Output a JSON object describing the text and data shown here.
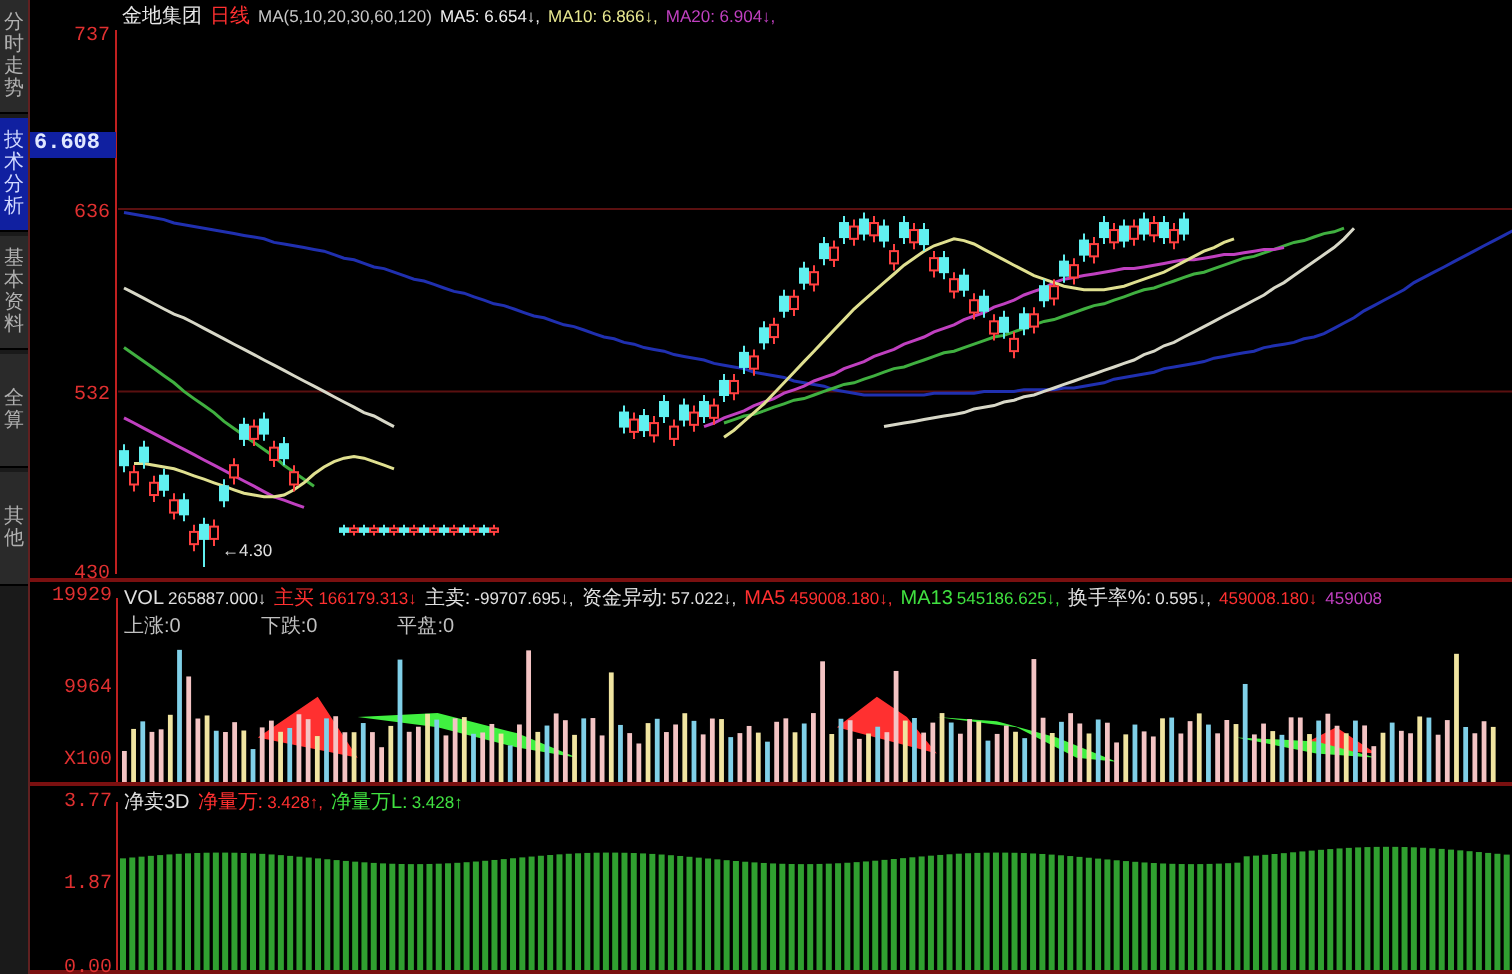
{
  "side_tabs": [
    {
      "label": "分时走势",
      "selected": false
    },
    {
      "label": "技术分析",
      "selected": true
    },
    {
      "label": "基本资料",
      "selected": false
    },
    {
      "label": "全算",
      "selected": false
    },
    {
      "label": "其他",
      "selected": false
    }
  ],
  "price_panel": {
    "current_price": "6.608",
    "low_marker": "←4.30",
    "legend": [
      {
        "label": "金地集团",
        "color": "#e8e8e8"
      },
      {
        "label": "日线",
        "color": "#ff3030"
      },
      {
        "value": "MA(5,10,20,30,60,120)",
        "color": "#c8c8c8"
      },
      {
        "value": "MA5: 6.654↓,",
        "color": "#f0f0f0"
      },
      {
        "value": "MA10: 6.866↓,",
        "color": "#e8e890"
      },
      {
        "value": "MA20: 6.904↓,",
        "color": "#c040c0"
      }
    ],
    "chart_data": {
      "type": "candlestick",
      "ylim": [
        428,
        738
      ],
      "yticks": [
        {
          "value": 737,
          "label": "737"
        },
        {
          "value": 636,
          "label": "636"
        },
        {
          "value": 532,
          "label": "532"
        },
        {
          "value": 430,
          "label": "430"
        }
      ],
      "ohlc": [
        [
          498,
          502,
          486,
          490
        ],
        [
          479,
          490,
          475,
          486
        ],
        [
          500,
          504,
          488,
          492
        ],
        [
          473,
          484,
          469,
          480
        ],
        [
          484,
          488,
          472,
          476
        ],
        [
          463,
          474,
          459,
          470
        ],
        [
          470,
          474,
          458,
          462
        ],
        [
          445,
          456,
          441,
          452
        ],
        [
          456,
          460,
          432,
          448
        ],
        [
          448,
          459,
          444,
          455
        ],
        [
          478,
          482,
          466,
          470
        ],
        [
          483,
          494,
          479,
          490
        ],
        [
          513,
          517,
          501,
          505
        ],
        [
          505,
          516,
          501,
          512
        ],
        [
          516,
          520,
          504,
          508
        ],
        [
          493,
          504,
          489,
          500
        ],
        [
          502,
          506,
          490,
          494
        ],
        [
          479,
          490,
          475,
          486
        ],
        null,
        null,
        null,
        null,
        [
          454,
          456,
          450,
          452
        ],
        [
          452,
          456,
          450,
          454
        ],
        [
          454,
          456,
          450,
          452
        ],
        [
          452,
          456,
          450,
          454
        ],
        [
          454,
          456,
          450,
          452
        ],
        [
          452,
          456,
          450,
          454
        ],
        [
          454,
          456,
          450,
          452
        ],
        [
          452,
          456,
          450,
          454
        ],
        [
          454,
          456,
          450,
          452
        ],
        [
          452,
          456,
          450,
          454
        ],
        [
          454,
          456,
          450,
          452
        ],
        [
          452,
          456,
          450,
          454
        ],
        [
          454,
          456,
          450,
          452
        ],
        [
          452,
          456,
          450,
          454
        ],
        [
          454,
          456,
          450,
          452
        ],
        [
          452,
          456,
          450,
          454
        ],
        null,
        null,
        null,
        null,
        null,
        null,
        null,
        null,
        null,
        null,
        null,
        null,
        [
          520,
          524,
          508,
          512
        ],
        [
          509,
          520,
          505,
          516
        ],
        [
          518,
          522,
          506,
          510
        ],
        [
          507,
          518,
          503,
          514
        ],
        [
          526,
          530,
          514,
          518
        ],
        [
          505,
          516,
          501,
          512
        ],
        [
          524,
          528,
          512,
          516
        ],
        [
          513,
          524,
          509,
          520
        ],
        [
          526,
          530,
          514,
          518
        ],
        [
          517,
          528,
          513,
          524
        ],
        [
          538,
          542,
          526,
          530
        ],
        [
          531,
          542,
          527,
          538
        ],
        [
          554,
          558,
          542,
          546
        ],
        [
          545,
          556,
          541,
          552
        ],
        [
          568,
          572,
          556,
          560
        ],
        [
          563,
          574,
          559,
          570
        ],
        [
          586,
          590,
          574,
          578
        ],
        [
          579,
          590,
          575,
          586
        ],
        [
          602,
          606,
          590,
          594
        ],
        [
          593,
          604,
          589,
          600
        ],
        [
          616,
          620,
          604,
          608
        ],
        [
          607,
          618,
          603,
          614
        ],
        [
          628,
          632,
          616,
          620
        ],
        [
          619,
          630,
          615,
          626
        ],
        [
          630,
          634,
          618,
          622
        ],
        [
          621,
          632,
          617,
          628
        ],
        [
          626,
          630,
          614,
          618
        ],
        [
          605,
          616,
          601,
          612
        ],
        [
          628,
          632,
          616,
          620
        ],
        [
          617,
          628,
          613,
          624
        ],
        [
          624,
          628,
          612,
          616
        ],
        [
          601,
          612,
          597,
          608
        ],
        [
          608,
          612,
          596,
          600
        ],
        [
          589,
          600,
          585,
          596
        ],
        [
          598,
          602,
          586,
          590
        ],
        [
          577,
          588,
          573,
          584
        ],
        [
          586,
          590,
          574,
          578
        ],
        [
          565,
          576,
          561,
          572
        ],
        [
          574,
          578,
          562,
          566
        ],
        [
          555,
          566,
          551,
          562
        ],
        [
          576,
          580,
          564,
          568
        ],
        [
          569,
          580,
          565,
          576
        ],
        [
          592,
          596,
          580,
          584
        ],
        [
          585,
          596,
          581,
          592
        ],
        [
          606,
          610,
          594,
          598
        ],
        [
          597,
          608,
          593,
          604
        ],
        [
          618,
          622,
          606,
          610
        ],
        [
          609,
          620,
          605,
          616
        ],
        [
          628,
          632,
          616,
          620
        ],
        [
          617,
          628,
          613,
          624
        ],
        [
          626,
          630,
          614,
          618
        ],
        [
          619,
          630,
          615,
          626
        ],
        [
          630,
          634,
          618,
          622
        ],
        [
          621,
          632,
          617,
          628
        ],
        [
          628,
          632,
          616,
          620
        ],
        [
          617,
          628,
          613,
          624
        ],
        [
          630,
          634,
          618,
          622
        ],
        null,
        null,
        null,
        null,
        null,
        null,
        null,
        null,
        null,
        null,
        null,
        null,
        null,
        null,
        null,
        null,
        null,
        null,
        null,
        null,
        null,
        null,
        null,
        null,
        null,
        null,
        null,
        null,
        null,
        null,
        null,
        null,
        null
      ],
      "series": [
        {
          "type": "line",
          "color": "#2030b0",
          "values": [
            634,
            633,
            632,
            631,
            630,
            628,
            627,
            626,
            625,
            624,
            623,
            622,
            621,
            620,
            619,
            617,
            616,
            615,
            614,
            613,
            612,
            610,
            608,
            607,
            605,
            603,
            602,
            600,
            598,
            596,
            595,
            593,
            591,
            589,
            588,
            586,
            584,
            582,
            581,
            579,
            577,
            575,
            574,
            572,
            570,
            569,
            567,
            565,
            563,
            562,
            560,
            559,
            557,
            556,
            555,
            553,
            552,
            551,
            550,
            548,
            547,
            546,
            545,
            543,
            542,
            541,
            540,
            538,
            537,
            536,
            535,
            533,
            532,
            531,
            530,
            530,
            530,
            530,
            530,
            530,
            530,
            531,
            531,
            531,
            531,
            531,
            532,
            532,
            532,
            532,
            533,
            533,
            533,
            533,
            534,
            534,
            535,
            536,
            537,
            539,
            540,
            541,
            542,
            543,
            545,
            546,
            547,
            548,
            549,
            551,
            552,
            553,
            554,
            555,
            557,
            558,
            559,
            560,
            562,
            563,
            565,
            568,
            571,
            574,
            578,
            581,
            584,
            587,
            590,
            594,
            597,
            600,
            603,
            606,
            609,
            612,
            615,
            618,
            621,
            624
          ]
        },
        {
          "type": "line",
          "color": "#d8d8c8",
          "values": [
            591,
            588,
            585,
            582,
            579,
            576,
            574,
            571,
            568,
            565,
            562,
            559,
            556,
            553,
            550,
            547,
            544,
            541,
            538,
            535,
            532,
            529,
            526,
            523,
            520,
            518,
            515,
            512,
            null,
            null,
            null,
            null,
            null,
            null,
            null,
            null,
            null,
            null,
            null,
            null,
            null,
            null,
            null,
            null,
            null,
            null,
            null,
            null,
            null,
            null,
            null,
            null,
            null,
            null,
            null,
            null,
            null,
            null,
            null,
            null,
            null,
            null,
            null,
            null,
            null,
            null,
            null,
            null,
            null,
            null,
            null,
            null,
            null,
            null,
            null,
            null,
            512,
            513,
            514,
            515,
            516,
            517,
            518,
            519,
            520,
            522,
            523,
            524,
            526,
            527,
            529,
            530,
            532,
            534,
            536,
            538,
            540,
            542,
            544,
            546,
            548,
            550,
            553,
            555,
            558,
            560,
            563,
            566,
            569,
            572,
            575,
            578,
            581,
            584,
            587,
            591,
            594,
            598,
            602,
            606,
            610,
            614,
            619,
            625,
            null,
            null,
            null,
            null,
            null,
            null,
            null,
            null,
            null,
            null,
            null,
            null,
            null,
            null,
            null,
            null
          ]
        },
        {
          "type": "line",
          "color": "#40b040",
          "values": [
            557,
            553,
            549,
            545,
            541,
            537,
            532,
            528,
            524,
            520,
            515,
            511,
            507,
            503,
            499,
            495,
            490,
            486,
            482,
            478,
            null,
            null,
            null,
            null,
            null,
            null,
            null,
            null,
            null,
            null,
            null,
            null,
            null,
            null,
            null,
            null,
            null,
            null,
            null,
            null,
            null,
            null,
            null,
            null,
            null,
            null,
            null,
            null,
            null,
            null,
            null,
            null,
            null,
            null,
            null,
            null,
            null,
            null,
            null,
            null,
            514,
            516,
            518,
            519,
            521,
            523,
            525,
            527,
            528,
            530,
            532,
            534,
            536,
            537,
            539,
            541,
            543,
            545,
            546,
            548,
            550,
            552,
            554,
            555,
            557,
            559,
            561,
            563,
            564,
            566,
            568,
            570,
            572,
            573,
            575,
            577,
            579,
            581,
            582,
            584,
            586,
            588,
            590,
            591,
            593,
            595,
            597,
            599,
            600,
            602,
            604,
            606,
            608,
            609,
            611,
            613,
            615,
            617,
            618,
            620,
            622,
            623,
            625,
            null,
            null,
            null,
            null,
            null,
            null,
            null,
            null,
            null,
            null,
            null,
            null,
            null,
            null,
            null,
            null,
            null
          ]
        },
        {
          "type": "line",
          "color": "#c040c0",
          "values": [
            517,
            514,
            511,
            508,
            505,
            502,
            499,
            496,
            493,
            490,
            487,
            484,
            481,
            478,
            475,
            472,
            470,
            468,
            466,
            null,
            null,
            null,
            null,
            null,
            null,
            null,
            null,
            null,
            null,
            null,
            null,
            null,
            null,
            null,
            null,
            null,
            null,
            null,
            null,
            null,
            null,
            null,
            null,
            null,
            null,
            null,
            null,
            null,
            null,
            null,
            null,
            null,
            null,
            null,
            null,
            null,
            null,
            null,
            512,
            514,
            517,
            519,
            521,
            524,
            526,
            528,
            531,
            533,
            535,
            538,
            540,
            542,
            545,
            547,
            549,
            552,
            554,
            556,
            559,
            561,
            563,
            566,
            568,
            570,
            573,
            575,
            577,
            580,
            582,
            584,
            587,
            589,
            591,
            594,
            596,
            597,
            598,
            599,
            600,
            601,
            602,
            602,
            603,
            604,
            605,
            606,
            607,
            607,
            608,
            609,
            610,
            610,
            611,
            612,
            613,
            613,
            614,
            null,
            null,
            null,
            null,
            null,
            null,
            null,
            null,
            null,
            null,
            null,
            null,
            null,
            null,
            null,
            null,
            null,
            null,
            null,
            null,
            null,
            null,
            null
          ]
        },
        {
          "type": "line",
          "color": "#e0e090",
          "values": [
            null,
            491,
            491,
            490,
            489,
            488,
            486,
            484,
            482,
            480,
            478,
            476,
            474,
            473,
            472,
            472,
            473,
            476,
            480,
            485,
            489,
            492,
            494,
            495,
            494,
            492,
            490,
            488,
            null,
            null,
            null,
            null,
            null,
            null,
            null,
            null,
            null,
            null,
            null,
            null,
            null,
            null,
            null,
            null,
            null,
            null,
            null,
            null,
            null,
            null,
            null,
            null,
            null,
            null,
            null,
            null,
            null,
            null,
            null,
            null,
            506,
            510,
            515,
            520,
            525,
            531,
            537,
            543,
            549,
            555,
            561,
            567,
            573,
            579,
            584,
            589,
            594,
            599,
            604,
            608,
            612,
            615,
            617,
            619,
            618,
            616,
            613,
            610,
            607,
            604,
            601,
            598,
            596,
            594,
            592,
            591,
            590,
            590,
            590,
            591,
            592,
            594,
            596,
            598,
            600,
            603,
            606,
            609,
            612,
            614,
            617,
            619,
            null,
            null,
            null,
            null,
            null,
            null,
            null,
            null,
            null,
            null,
            null,
            null,
            null,
            null,
            null,
            null,
            null,
            null,
            null,
            null,
            null,
            null,
            null,
            null,
            null,
            null,
            null,
            null
          ]
        }
      ]
    }
  },
  "volume_panel": {
    "axis_labels": [
      "19929",
      "9964",
      "X100"
    ],
    "legend": [
      {
        "label": "VOL",
        "value": "265887.000↓",
        "color": "#e0e0e0"
      },
      {
        "label": "主买",
        "value": "166179.313↓",
        "color": "#ff3030"
      },
      {
        "label": "主卖:",
        "value": "-99707.695↓,",
        "color": "#e0e0e0"
      },
      {
        "label": "资金异动:",
        "value": "57.022↓,",
        "color": "#e0e0e0"
      },
      {
        "label": "MA5",
        "value": "459008.180↓,",
        "color": "#ff3030"
      },
      {
        "label": "MA13",
        "value": "545186.625↓,",
        "color": "#40e040"
      },
      {
        "label": "换手率%:",
        "value": "0.595↓,",
        "color": "#e0e0e0"
      },
      {
        "value": "459008.180↓",
        "color": "#ff3030"
      },
      {
        "value": "459008",
        "color": "#c040c0"
      }
    ],
    "counts": [
      {
        "label": "上涨:",
        "value": "0"
      },
      {
        "label": "下跌:",
        "value": "0"
      },
      {
        "label": "平盘:",
        "value": "0"
      }
    ]
  },
  "indicator_panel": {
    "axis_labels": [
      "3.77",
      "1.87",
      "0.00"
    ],
    "legend": [
      {
        "label": "净卖3D",
        "color": "#e0e0e0"
      },
      {
        "label": "净量万:",
        "value": "3.428↑,",
        "color": "#ff3030"
      },
      {
        "label": "净量万L:",
        "value": "3.428↑",
        "color": "#40e040"
      }
    ]
  }
}
